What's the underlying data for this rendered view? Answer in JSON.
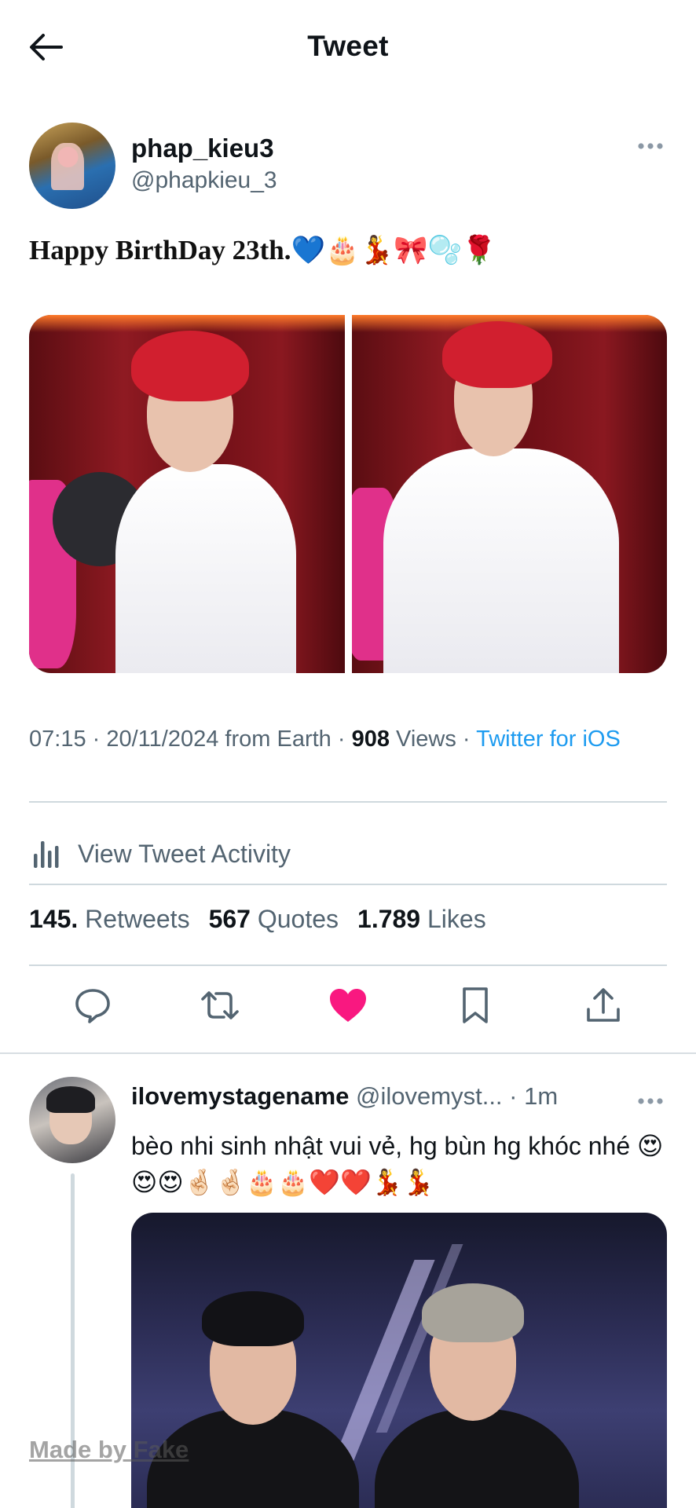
{
  "header": {
    "title": "Tweet",
    "back_icon": "arrow-left-icon"
  },
  "tweet": {
    "author": {
      "display_name": "phap_kieu3",
      "handle": "@phapkieu_3"
    },
    "text": "Happy BirthDay 23th.💙🎂💃🎀🫧🌹",
    "media_count": 2,
    "meta": {
      "time": "07:15",
      "date": "20/11/2024",
      "location": "from Earth",
      "views_count": "908",
      "views_label": "Views",
      "client": "Twitter for iOS",
      "sep": " · "
    },
    "activity_label": "View Tweet Activity",
    "stats": {
      "retweets_count": "145.",
      "retweets_label": "Retweets",
      "quotes_count": "567",
      "quotes_label": "Quotes",
      "likes_count": "1.789",
      "likes_label": "Likes"
    },
    "actions": {
      "reply_icon": "speech-bubble-icon",
      "retweet_icon": "retweet-icon",
      "like_icon": "heart-filled-icon",
      "bookmark_icon": "bookmark-icon",
      "share_icon": "share-upload-icon",
      "liked": true,
      "like_color": "#f91880"
    }
  },
  "reply": {
    "display_name": "ilovemystagename",
    "handle": "@ilovemyst...",
    "time": "1m",
    "sep": " · ",
    "text": "bèo nhi sinh nhật vui vẻ, hg bùn hg khóc nhé 😍😍😍🤞🏻🤞🏻🎂🎂❤️❤️💃💃"
  },
  "watermark": "Made by Fake",
  "colors": {
    "link": "#1d9bf0",
    "secondary_text": "#536471",
    "divider": "#cfd9de",
    "primary_text": "#0f1419"
  }
}
